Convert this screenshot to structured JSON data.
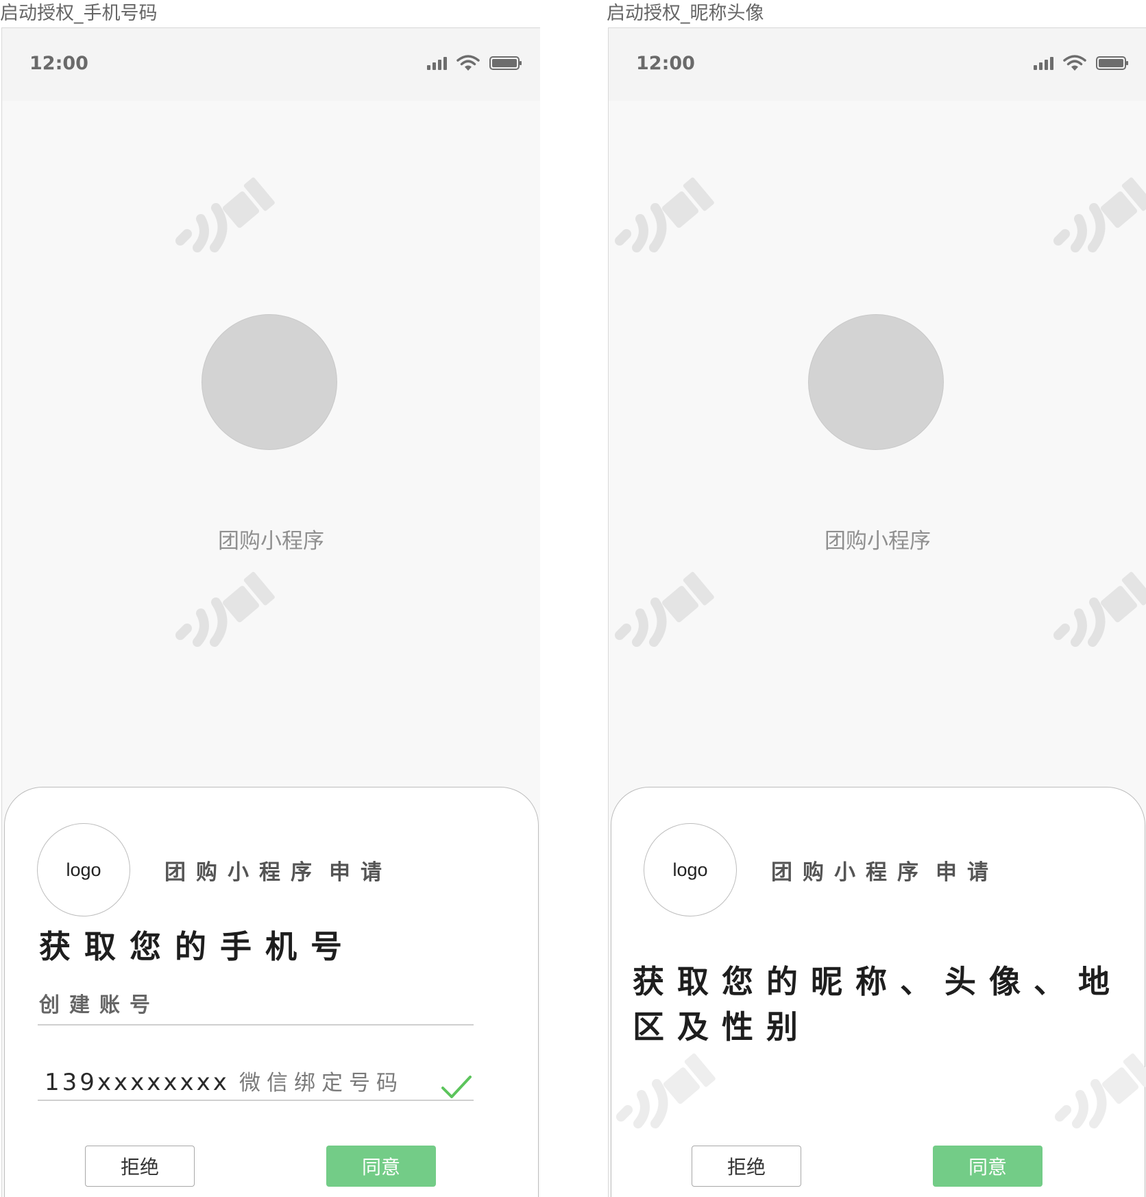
{
  "screens": [
    {
      "frame_title": "启动授权_手机号码",
      "status": {
        "time": "12:00"
      },
      "app_name": "团购小程序",
      "sheet": {
        "logo_text": "logo",
        "app_line": "团购小程序",
        "request_label": "申请",
        "heading": "获取您的手机号",
        "subheading": "创建账号",
        "phone_value": "139xxxxxxxx",
        "phone_hint": "微信绑定号码",
        "reject_label": "拒绝",
        "accept_label": "同意"
      }
    },
    {
      "frame_title": "启动授权_昵称头像",
      "status": {
        "time": "12:00"
      },
      "app_name": "团购小程序",
      "sheet": {
        "logo_text": "logo",
        "app_line": "团购小程序",
        "request_label": "申请",
        "heading": "获取您的昵称、头像、地区及性别",
        "reject_label": "拒绝",
        "accept_label": "同意"
      }
    }
  ],
  "icons": {
    "signal": "signal-icon",
    "wifi": "wifi-icon",
    "battery": "battery-icon",
    "check": "check-icon"
  },
  "colors": {
    "accent_green": "#73cc87",
    "check_green": "#5cc45c",
    "placeholder_gray": "#d3d3d3"
  }
}
